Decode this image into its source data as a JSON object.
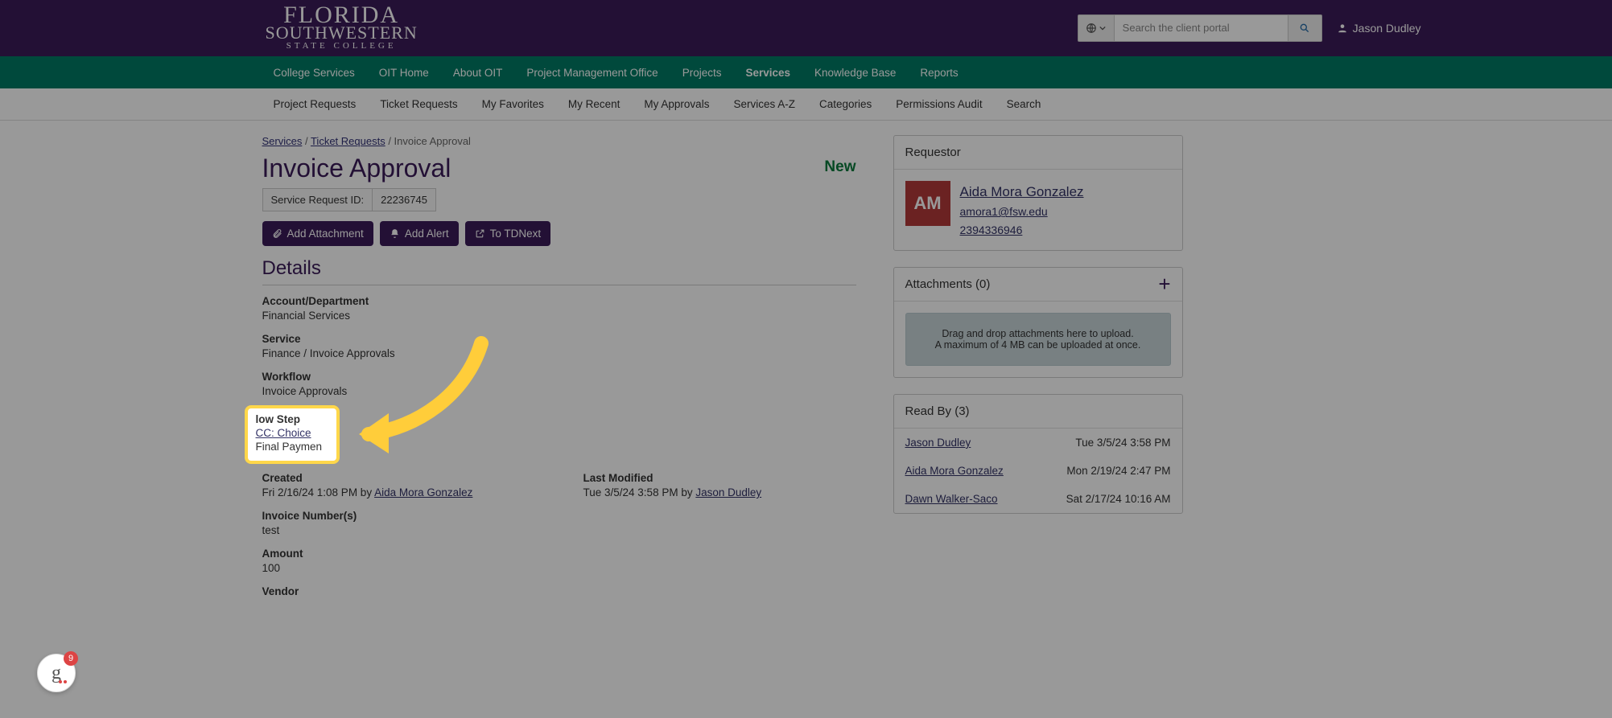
{
  "header": {
    "logo": {
      "line1": "FLORIDA",
      "line2": "SOUTHWESTERN",
      "line3": "STATE COLLEGE"
    },
    "search_placeholder": "Search the client portal",
    "user_name": "Jason Dudley"
  },
  "nav_primary": {
    "items": [
      "College Services",
      "OIT Home",
      "About OIT",
      "Project Management Office",
      "Projects",
      "Services",
      "Knowledge Base",
      "Reports"
    ],
    "active_index": 5
  },
  "nav_secondary": {
    "items": [
      "Project Requests",
      "Ticket Requests",
      "My Favorites",
      "My Recent",
      "My Approvals",
      "Services A-Z",
      "Categories",
      "Permissions Audit",
      "Search"
    ]
  },
  "breadcrumb": {
    "items": [
      "Services",
      "Ticket Requests",
      "Invoice Approval"
    ]
  },
  "page": {
    "title": "Invoice Approval",
    "new_link": "New",
    "srid_label": "Service Request ID:",
    "srid_value": "22236745",
    "buttons": {
      "attach": "Add Attachment",
      "alert": "Add Alert",
      "tdnext": "To TDNext"
    },
    "details_heading": "Details"
  },
  "details": {
    "account_label": "Account/Department",
    "account_value": "Financial Services",
    "service_label": "Service",
    "service_value": "Finance / Invoice Approvals",
    "workflow_label": "Workflow",
    "workflow_value": "Invoice Approvals",
    "curstep_tail": "low Step",
    "cc_choice": "CC: Choice",
    "final_partial": "Final Paymen",
    "created_label": "Created",
    "created_prefix": "Fri 2/16/24 1:08 PM by ",
    "created_by": "Aida Mora Gonzalez",
    "modified_label": "Last Modified",
    "modified_prefix": "Tue 3/5/24 3:58 PM by ",
    "modified_by": "Jason Dudley",
    "invoice_label": "Invoice Number(s)",
    "invoice_value": "test",
    "amount_label": "Amount",
    "amount_value": "100",
    "vendor_label": "Vendor"
  },
  "requestor": {
    "heading": "Requestor",
    "initials": "AM",
    "name": "Aida Mora Gonzalez",
    "email": "amora1@fsw.edu",
    "phone": "2394336946"
  },
  "attachments": {
    "heading": "Attachments (0)",
    "drop_line1": "Drag and drop attachments here to upload.",
    "drop_line2": "A maximum of 4 MB can be uploaded at once."
  },
  "readby": {
    "heading": "Read By (3)",
    "rows": [
      {
        "name": "Jason Dudley",
        "time": "Tue 3/5/24 3:58 PM"
      },
      {
        "name": "Aida Mora Gonzalez",
        "time": "Mon 2/19/24 2:47 PM"
      },
      {
        "name": "Dawn Walker-Saco",
        "time": "Sat 2/17/24 10:16 AM"
      }
    ]
  },
  "widget": {
    "badge": "9"
  }
}
